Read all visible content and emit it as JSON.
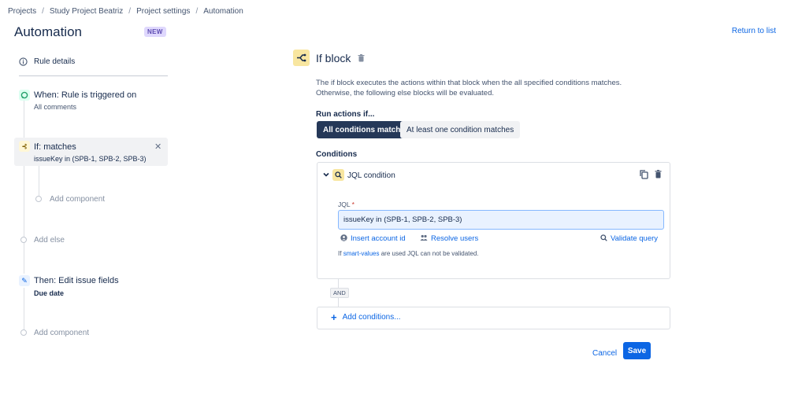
{
  "breadcrumb": {
    "items": [
      "Projects",
      "Study Project Beatriz",
      "Project settings",
      "Automation"
    ],
    "separator": "/"
  },
  "header": {
    "title": "Automation",
    "badge": "NEW",
    "return_link": "Return to list"
  },
  "rule": {
    "details_label": "Rule details",
    "trigger": {
      "title": "When: Rule is triggered on",
      "subtitle": "All comments",
      "icon": "comment-trigger-icon"
    },
    "condition": {
      "title": "If: matches",
      "subtitle": "issueKey in (SPB-1, SPB-2, SPB-3)",
      "icon": "branch-icon"
    },
    "add_component_inner": "Add component",
    "add_else": "Add else",
    "action": {
      "title": "Then: Edit issue fields",
      "subtitle": "Due date",
      "icon": "pencil-icon"
    },
    "add_component_outer": "Add component"
  },
  "panel": {
    "title": "If block",
    "description_line1": "The if block executes the actions within that block when the all specified conditions matches.",
    "description_line2": "Otherwise, the following else blocks will be evaluated.",
    "run_actions_label": "Run actions if...",
    "options": [
      "All conditions match",
      "At least one condition matches"
    ],
    "selected_option": "All conditions match",
    "conditions_label": "Conditions",
    "condition": {
      "title": "JQL condition",
      "jql_label": "JQL",
      "required_marker": "*",
      "jql_value": "issueKey in (SPB-1, SPB-2, SPB-3)",
      "insert_account_id": "Insert account id",
      "resolve_users": "Resolve users",
      "validate_query": "Validate query",
      "hint_prefix": "If",
      "hint_link": "smart-values",
      "hint_suffix": "are used JQL can not be validated."
    },
    "and_badge": "AND",
    "add_conditions": "Add conditions...",
    "cancel": "Cancel",
    "save": "Save"
  },
  "colors": {
    "primary": "#0c66e4",
    "selected_segment": "#253858",
    "condition_icon_bg": "#f8e6a0"
  }
}
